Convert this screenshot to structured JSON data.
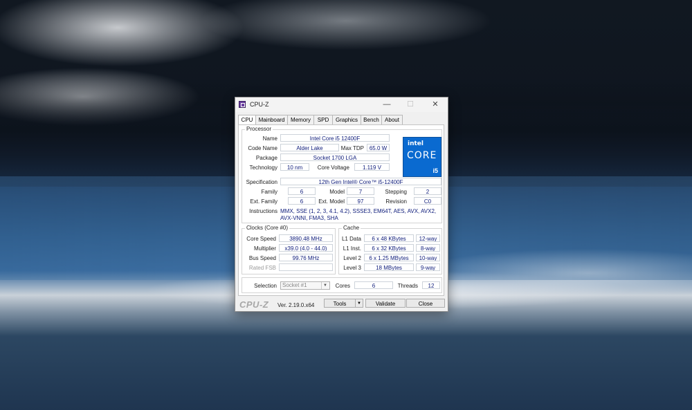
{
  "window": {
    "title": "CPU-Z",
    "min": "—",
    "max": "☐",
    "close": "✕"
  },
  "tabs": [
    "CPU",
    "Mainboard",
    "Memory",
    "SPD",
    "Graphics",
    "Bench",
    "About"
  ],
  "processor": {
    "group_title": "Processor",
    "name_label": "Name",
    "name": "Intel Core i5 12400F",
    "codename_label": "Code Name",
    "codename": "Alder Lake",
    "maxtdp_label": "Max TDP",
    "maxtdp": "65.0 W",
    "package_label": "Package",
    "package": "Socket 1700 LGA",
    "technology_label": "Technology",
    "technology": "10 nm",
    "voltage_label": "Core Voltage",
    "voltage": "1.119 V",
    "spec_label": "Specification",
    "spec": "12th Gen Intel® Core™ i5-12400F",
    "family_label": "Family",
    "family": "6",
    "model_label": "Model",
    "model": "7",
    "stepping_label": "Stepping",
    "stepping": "2",
    "extfamily_label": "Ext. Family",
    "extfamily": "6",
    "extmodel_label": "Ext. Model",
    "extmodel": "97",
    "revision_label": "Revision",
    "revision": "C0",
    "instructions_label": "Instructions",
    "instructions": "MMX, SSE (1, 2, 3, 4.1, 4.2), SSSE3, EM64T, AES, AVX, AVX2, AVX-VNNI, FMA3, SHA"
  },
  "logo": {
    "brand": "intel",
    "core": "CORE",
    "tier": "i5"
  },
  "clocks": {
    "group_title": "Clocks (Core #0)",
    "speed_label": "Core Speed",
    "speed": "3890.48 MHz",
    "mult_label": "Multiplier",
    "mult": "x39.0 (4.0 - 44.0)",
    "bus_label": "Bus Speed",
    "bus": "99.76 MHz",
    "fsb_label": "Rated FSB",
    "fsb": ""
  },
  "cache": {
    "group_title": "Cache",
    "l1d_label": "L1 Data",
    "l1d": "6 x 48 KBytes",
    "l1d_way": "12-way",
    "l1i_label": "L1 Inst.",
    "l1i": "6 x 32 KBytes",
    "l1i_way": "8-way",
    "l2_label": "Level 2",
    "l2": "6 x 1.25 MBytes",
    "l2_way": "10-way",
    "l3_label": "Level 3",
    "l3": "18 MBytes",
    "l3_way": "9-way"
  },
  "selection": {
    "label": "Selection",
    "value": "Socket #1",
    "cores_label": "Cores",
    "cores": "6",
    "threads_label": "Threads",
    "threads": "12"
  },
  "footer": {
    "logo": "CPU-Z",
    "version": "Ver. 2.19.0.x64",
    "tools": "Tools",
    "validate": "Validate",
    "close": "Close"
  }
}
